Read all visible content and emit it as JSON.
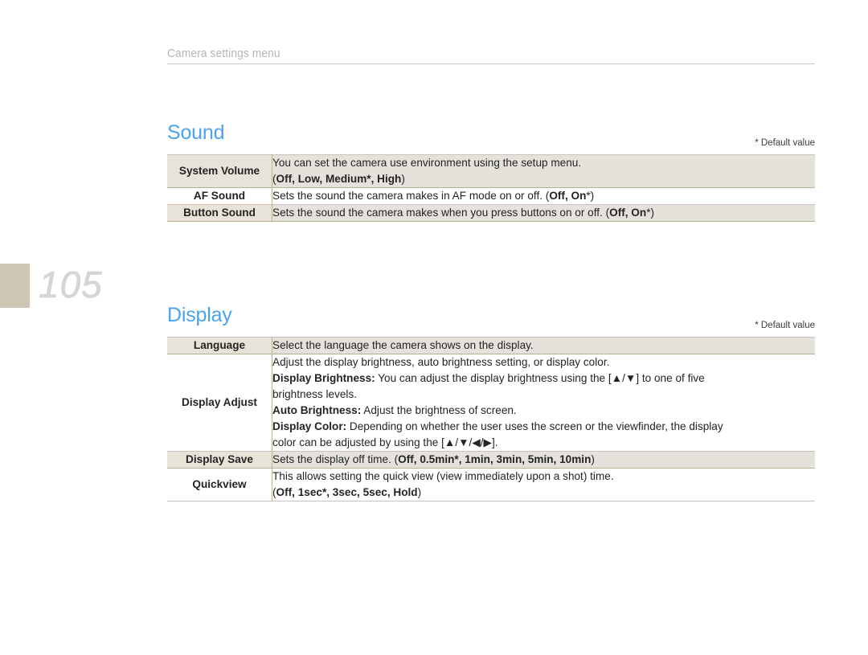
{
  "running_header": "Camera settings menu",
  "page_number": "105",
  "sections": [
    {
      "title": "Sound",
      "default_note": "* Default value",
      "rows": [
        {
          "label": "System Volume",
          "lines": [
            {
              "text": "You can set the camera use environment using the setup menu."
            },
            {
              "text": "(",
              "bold": "Off, Low, Medium*, High",
              "after": ")"
            }
          ]
        },
        {
          "label": "AF Sound",
          "lines": [
            {
              "text": "Sets the sound the camera makes in AF mode on or off. (",
              "bold": "Off, On",
              "after": "*)"
            }
          ]
        },
        {
          "label": "Button Sound",
          "lines": [
            {
              "text": "Sets the sound the camera makes when you press buttons on or off. (",
              "bold": "Off, On",
              "after": "*)"
            }
          ]
        }
      ]
    },
    {
      "title": "Display",
      "default_note": "* Default value",
      "rows": [
        {
          "label": "Language",
          "lines": [
            {
              "text": "Select the language the camera shows on the display."
            }
          ]
        },
        {
          "label": "Display Adjust",
          "lines": [
            {
              "text": "Adjust the display brightness, auto brightness setting, or display color."
            },
            {
              "bold_lead": "Display Brightness:",
              "text": " You can adjust the display brightness using the [▲/▼] to one of five"
            },
            {
              "text": "brightness levels."
            },
            {
              "bold_lead": "Auto Brightness:",
              "text": " Adjust the brightness of screen."
            },
            {
              "bold_lead": "Display Color:",
              "text": " Depending on whether the user uses the screen or the viewfinder, the display"
            },
            {
              "text": "color can be adjusted by using the [▲/▼/◀/▶]."
            }
          ]
        },
        {
          "label": "Display Save",
          "lines": [
            {
              "text": "Sets the display off time. (",
              "bold": "Off, 0.5min*, 1min, 3min, 5min, 10min",
              "after": ")"
            }
          ]
        },
        {
          "label": "Quickview",
          "lines": [
            {
              "text": "This allows setting the quick view (view immediately upon a shot) time."
            },
            {
              "text": "(",
              "bold": "Off, 1sec*, 3sec, 5sec, Hold",
              "after": ")"
            }
          ]
        }
      ]
    }
  ]
}
